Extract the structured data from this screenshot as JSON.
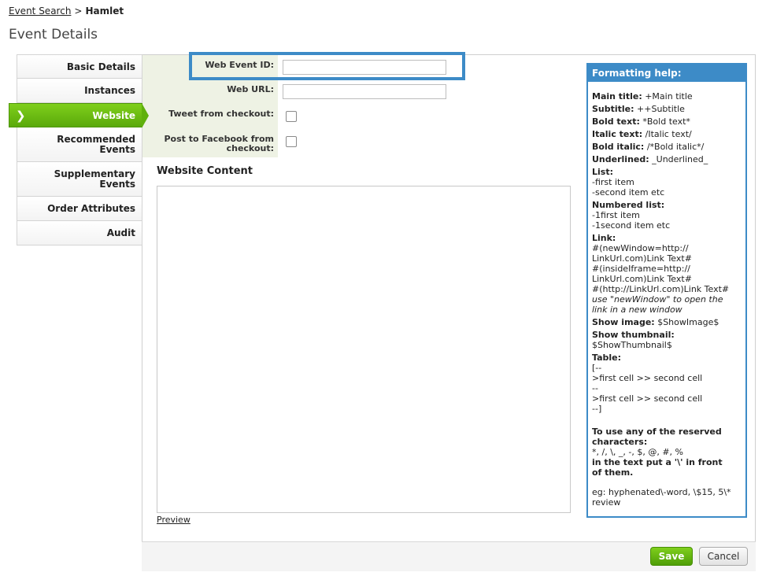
{
  "breadcrumb": {
    "link": "Event Search",
    "separator": ">",
    "current": "Hamlet"
  },
  "page_title": "Event Details",
  "sidebar": {
    "items": [
      {
        "label": "Basic Details"
      },
      {
        "label": "Instances"
      },
      {
        "label": "Website",
        "active": true
      },
      {
        "label": "Recommended Events"
      },
      {
        "label": "Supplementary Events"
      },
      {
        "label": "Order Attributes"
      },
      {
        "label": "Audit"
      }
    ]
  },
  "form": {
    "web_event_id": {
      "label": "Web Event ID:",
      "value": ""
    },
    "web_url": {
      "label": "Web URL:",
      "value": ""
    },
    "tweet": {
      "label": "Tweet from checkout:",
      "checked": false
    },
    "facebook": {
      "label": "Post to Facebook from checkout:",
      "checked": false
    }
  },
  "content": {
    "title": "Website Content",
    "value": "",
    "preview_label": "Preview"
  },
  "help": {
    "title": "Formatting help:",
    "main_title_k": "Main title:",
    "main_title_v": "+Main title",
    "subtitle_k": "Subtitle:",
    "subtitle_v": "++Subtitle",
    "bold_k": "Bold text:",
    "bold_v": "*Bold text*",
    "italic_k": "Italic text:",
    "italic_v": "/Italic text/",
    "bolditalic_k": "Bold italic:",
    "bolditalic_v": "/*Bold italic*/",
    "underlined_k": "Underlined:",
    "underlined_v": "_Underlined_",
    "list_k": "List:",
    "list_v1": "-first item",
    "list_v2": "-second item etc",
    "numbered_k": "Numbered list:",
    "numbered_v1": "-1first item",
    "numbered_v2": "-1second item etc",
    "link_k": "Link:",
    "link_v1": "#(newWindow=http://",
    "link_v2": "LinkUrl.com)Link Text#",
    "link_v3": "#(insideIframe=http://",
    "link_v4": "LinkUrl.com)Link Text#",
    "link_v5": "#(http://LinkUrl.com)Link Text#",
    "link_note1": "use \"newWindow\" to open the",
    "link_note2": "link in a new window",
    "showimage_k": "Show image:",
    "showimage_v": "$ShowImage$",
    "showthumb_k": "Show thumbnail:",
    "showthumb_v": "$ShowThumbnail$",
    "table_k": "Table:",
    "table_v1": "[--",
    "table_v2": ">first cell >> second cell",
    "table_v3": "--",
    "table_v4": ">first cell >> second cell",
    "table_v5": "--]",
    "reserved_1": "To use any of the reserved",
    "reserved_2": "characters:",
    "reserved_chars": "*, /, \\, _, -, $, @, #, %",
    "reserved_3": "in the text put a '\\' in front",
    "reserved_4": "of them.",
    "example_1": "eg: hyphenated\\-word, \\$15, 5\\*",
    "example_2": "review"
  },
  "buttons": {
    "save": "Save",
    "cancel": "Cancel"
  },
  "colors": {
    "accent_green": "#5aa90a",
    "accent_blue": "#3d8bc7"
  }
}
